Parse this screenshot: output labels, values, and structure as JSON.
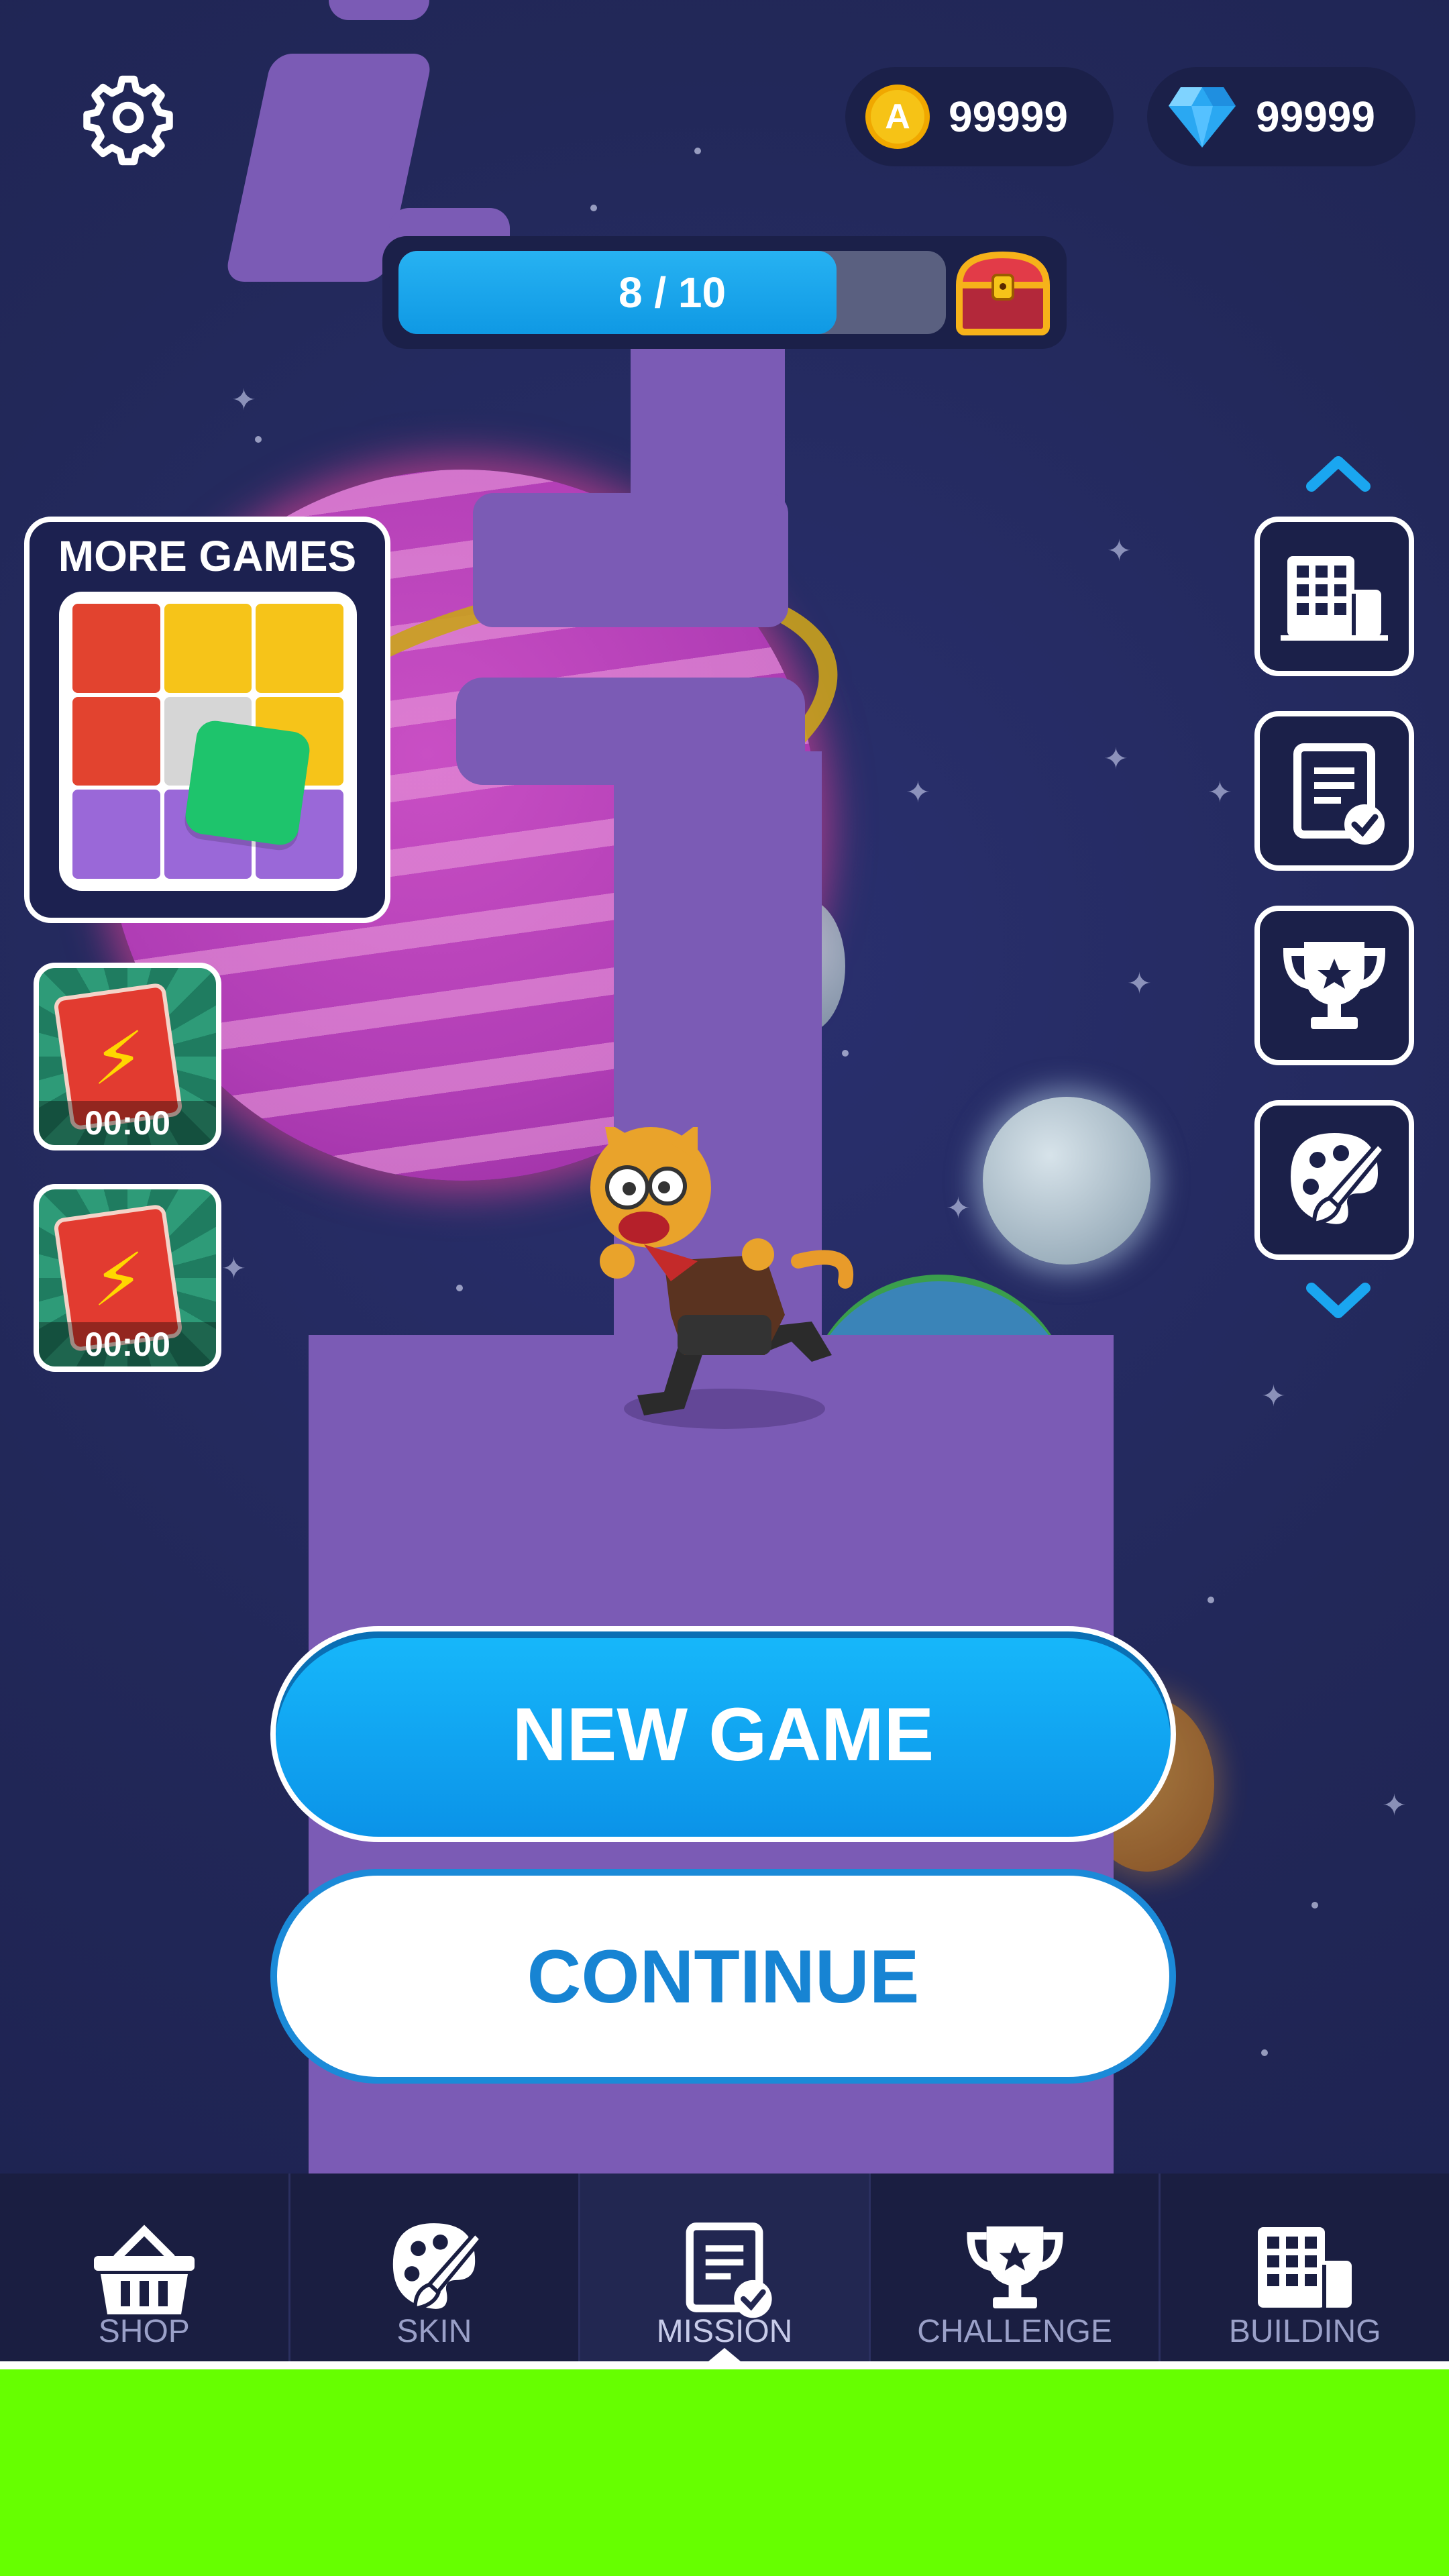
{
  "hud": {
    "coins": "99999",
    "gems": "99999",
    "coin_symbol": "A",
    "progress_text": "8 / 10",
    "progress_fraction": 0.8,
    "settings_icon": "gear-icon",
    "chest_icon": "treasure-chest-icon"
  },
  "more_games": {
    "title": "MORE GAMES",
    "grid_colors": [
      "#e2432f",
      "#f6c419",
      "#f6c419",
      "#e2432f",
      "#d6d6d6",
      "#f6c419",
      "#9a68d8",
      "#9a68d8",
      "#9a68d8"
    ],
    "piece_color": "#1ec46c"
  },
  "boosts": [
    {
      "timer": "00:00",
      "icon": "lightning-card-icon"
    },
    {
      "timer": "00:00",
      "icon": "lightning-card-icon"
    }
  ],
  "side_menu": {
    "up_icon": "chevron-up-icon",
    "down_icon": "chevron-down-icon",
    "items": [
      {
        "icon": "building-icon"
      },
      {
        "icon": "mission-icon"
      },
      {
        "icon": "trophy-icon"
      },
      {
        "icon": "palette-icon"
      }
    ]
  },
  "buttons": {
    "new_game": "NEW GAME",
    "continue": "CONTINUE"
  },
  "nav": {
    "active": "MISSION",
    "items": [
      {
        "label": "SHOP",
        "icon": "basket-icon"
      },
      {
        "label": "SKIN",
        "icon": "palette-icon"
      },
      {
        "label": "MISSION",
        "icon": "mission-icon"
      },
      {
        "label": "CHALLENGE",
        "icon": "trophy-icon"
      },
      {
        "label": "BUILDING",
        "icon": "building-icon"
      }
    ]
  },
  "colors": {
    "accent_blue": "#17b8fb",
    "continue_blue": "#1784d3",
    "path_purple": "#7b5bb5",
    "background": "#23295a",
    "bottom_green": "#66ff00"
  }
}
